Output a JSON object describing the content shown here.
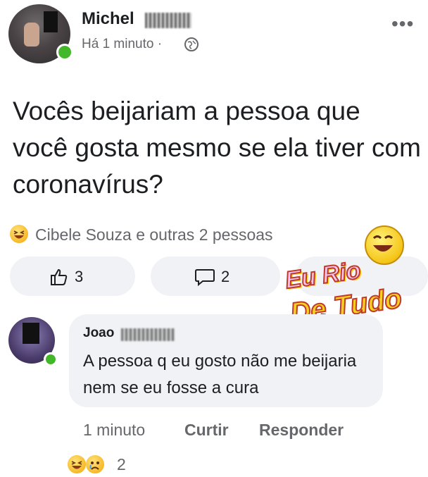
{
  "post": {
    "author": "Michel",
    "time": "Há 1 minuto",
    "separator": "·",
    "more_icon": "more-options-icon",
    "text": "Vocês beijariam a pessoa que você gosta mesmo se ela tiver com coronavírus?",
    "reactions_summary": "Cibele Souza e outras 2 pessoas",
    "like_count": "3",
    "comment_count": "2"
  },
  "watermark": {
    "line1": "Eu Rio",
    "line2": "De Tudo"
  },
  "comment": {
    "author": "Joao",
    "text": "A pessoa q eu gosto não me beijaria nem se eu fosse a cura",
    "time": "1 minuto",
    "like_label": "Curtir",
    "reply_label": "Responder",
    "reaction_count": "2"
  },
  "colors": {
    "online": "#42b72a",
    "pill_bg": "#f0f2f5",
    "muted_text": "#65676b"
  }
}
